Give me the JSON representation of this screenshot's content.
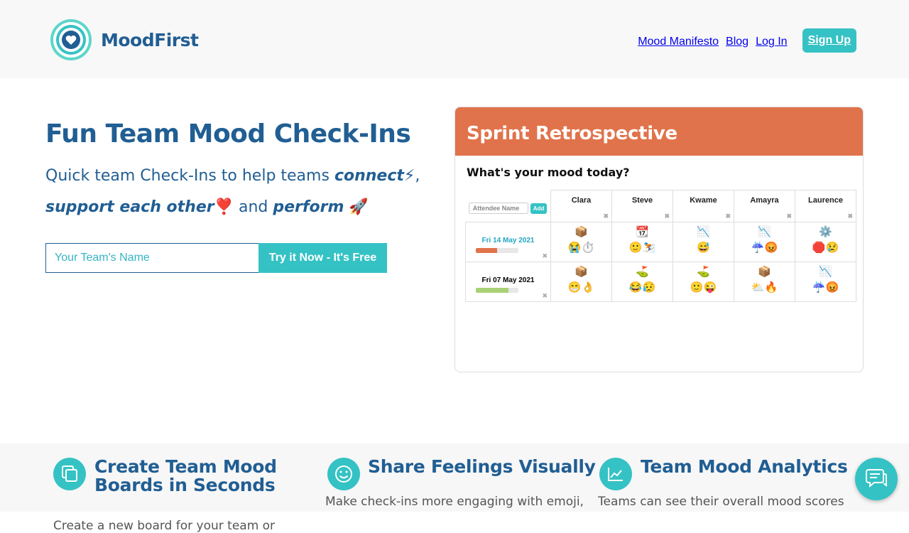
{
  "brand": {
    "name": "MoodFirst",
    "logo_icon": "heart-target-logo",
    "accent": "#35c2c4",
    "primary": "#215e93"
  },
  "nav": {
    "links": [
      "Mood Manifesto",
      "Blog",
      "Log In"
    ],
    "signup": "Sign Up"
  },
  "hero": {
    "title": "Fun Team Mood Check-Ins",
    "sub_1": "Quick team Check-Ins to help teams ",
    "sub_connect": "connect",
    "sub_connect_emoji": "⚡",
    "sub_comma": ",",
    "sub_support": "support each other",
    "sub_heart_emoji": "❣️",
    "sub_and": " and ",
    "sub_perform": "perform",
    "sub_rocket_emoji": "🚀",
    "input_placeholder": "Your Team's Name",
    "cta": "Try it Now - It's Free"
  },
  "preview": {
    "title": "Sprint Retrospective",
    "question": "What's your mood today?",
    "attendee_placeholder": "Attendee Name",
    "add_label": "Add",
    "remove_glyph": "✖",
    "people": [
      "Clara",
      "Steve",
      "Kwame",
      "Amayra",
      "Laurence"
    ],
    "rows": [
      {
        "date": "Fri 14 May 2021",
        "mood_level": 0.5,
        "mood_color": "#e0734b",
        "cells": [
          {
            "top": "📦",
            "bottom": "😭⏱️"
          },
          {
            "top": "📆",
            "bottom": "🙂⛷️"
          },
          {
            "top": "📉",
            "bottom": "😅"
          },
          {
            "top": "📉",
            "bottom": "☔😡"
          },
          {
            "top": "⚙️",
            "bottom": "🛑😢"
          }
        ]
      },
      {
        "date": "Fri 07 May 2021",
        "mood_level": 0.77,
        "mood_color": "#a8d275",
        "cells": [
          {
            "top": "📦",
            "bottom": "😁👌"
          },
          {
            "top": "⛳",
            "bottom": "😂😥"
          },
          {
            "top": "⛳",
            "bottom": "🙂😜"
          },
          {
            "top": "📦",
            "bottom": "⛅🔥"
          },
          {
            "top": "📉",
            "bottom": "☔😡"
          }
        ]
      }
    ]
  },
  "features": [
    {
      "icon": "copy-icon",
      "title": "Create Team Mood Boards in Seconds",
      "text": "Create a new board for your team or"
    },
    {
      "icon": "smiley-icon",
      "title": "Share Feelings Visually",
      "text": "Make check-ins more engaging with emoji,"
    },
    {
      "icon": "trend-chart-icon",
      "title": "Team Mood Analytics",
      "text": "Teams can see their overall mood scores"
    }
  ],
  "chat": {
    "icon": "chat-bubble-icon"
  }
}
